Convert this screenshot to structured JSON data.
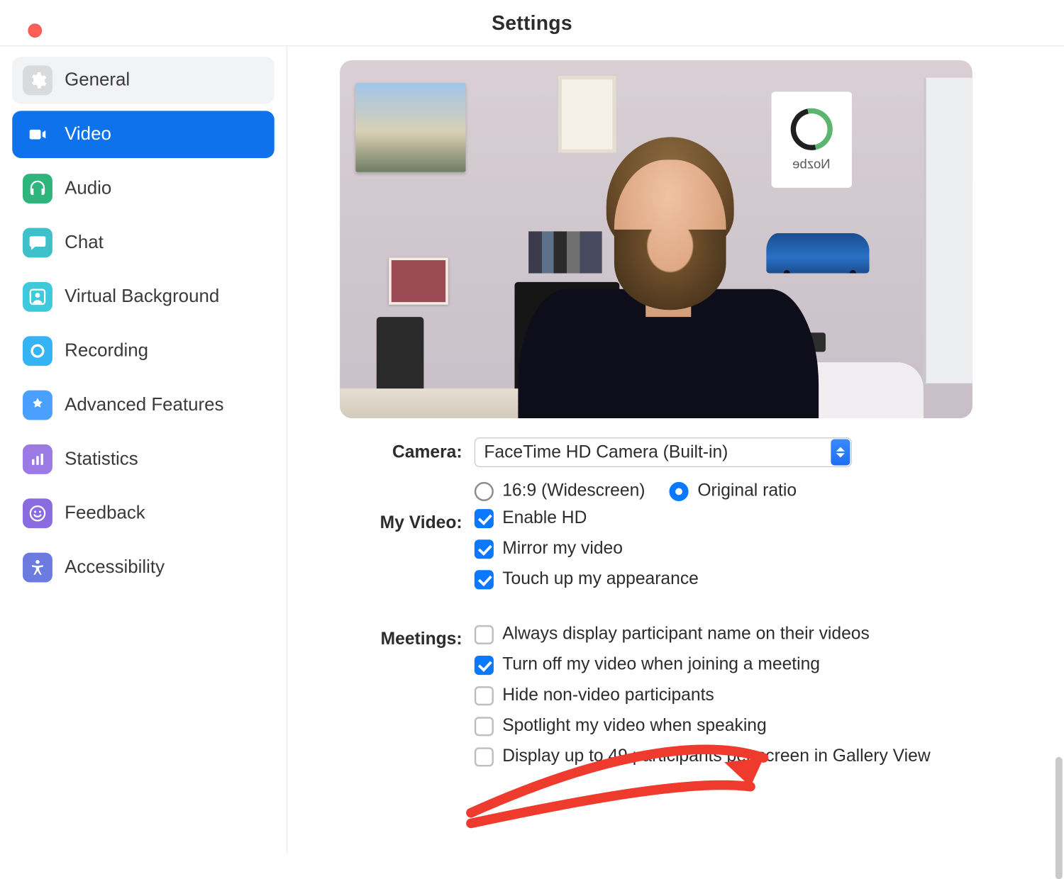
{
  "window": {
    "title": "Settings"
  },
  "sidebar": {
    "items": [
      {
        "label": "General"
      },
      {
        "label": "Video"
      },
      {
        "label": "Audio"
      },
      {
        "label": "Chat"
      },
      {
        "label": "Virtual Background"
      },
      {
        "label": "Recording"
      },
      {
        "label": "Advanced Features"
      },
      {
        "label": "Statistics"
      },
      {
        "label": "Feedback"
      },
      {
        "label": "Accessibility"
      }
    ]
  },
  "preview": {
    "poster_text": "Nozbe"
  },
  "camera": {
    "label": "Camera:",
    "selected": "FaceTime HD Camera (Built-in)",
    "ratio_16_9": "16:9 (Widescreen)",
    "ratio_original": "Original ratio"
  },
  "my_video": {
    "label": "My Video:",
    "enable_hd": "Enable HD",
    "mirror": "Mirror my video",
    "touch_up": "Touch up my appearance"
  },
  "meetings": {
    "label": "Meetings:",
    "display_name": "Always display participant name on their videos",
    "turn_off": "Turn off my video when joining a meeting",
    "hide_nonvideo": "Hide non-video participants",
    "spotlight": "Spotlight my video when speaking",
    "gallery49": "Display up to 49 participants per screen in Gallery View"
  }
}
